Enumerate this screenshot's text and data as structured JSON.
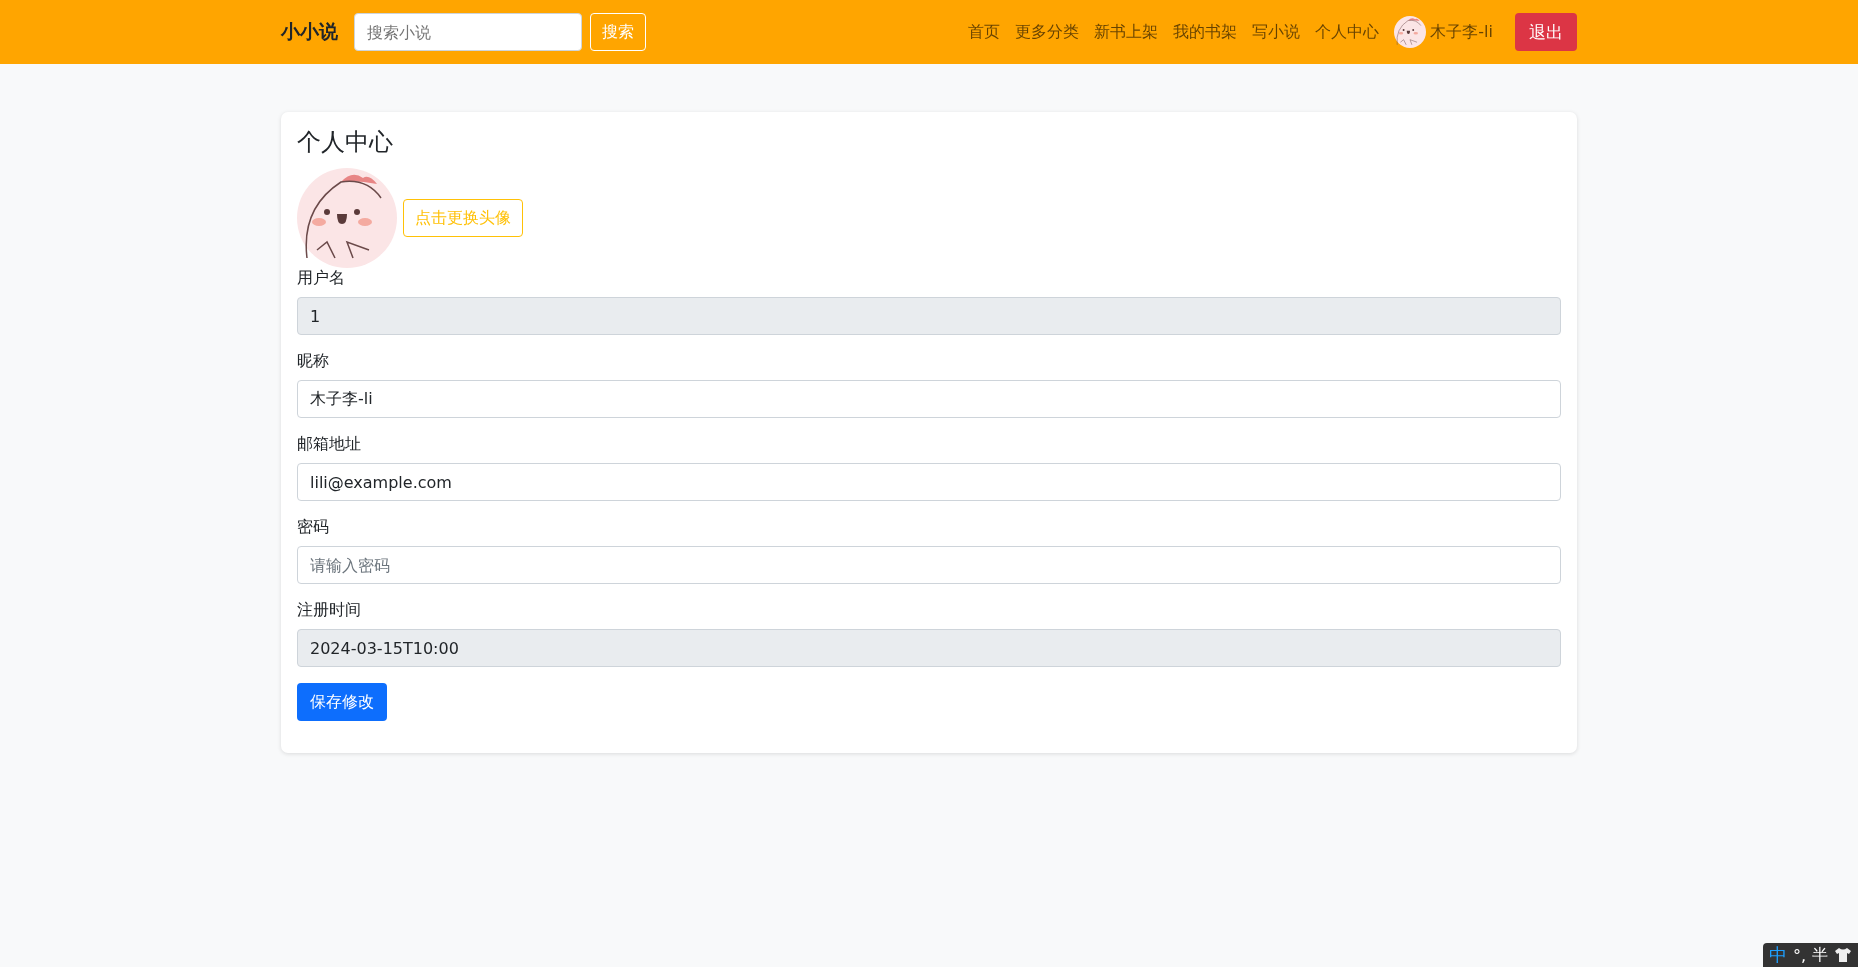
{
  "navbar": {
    "brand": "小小说",
    "search": {
      "placeholder": "搜索小说",
      "button": "搜索"
    },
    "links": [
      {
        "label": "首页"
      },
      {
        "label": "更多分类"
      },
      {
        "label": "新书上架"
      },
      {
        "label": "我的书架"
      },
      {
        "label": "写小说"
      },
      {
        "label": "个人中心"
      }
    ],
    "user": {
      "name": "木子李-li"
    },
    "logout": "退出"
  },
  "card": {
    "title": "个人中心",
    "change_avatar": "点击更换头像",
    "fields": [
      {
        "label": "用户名",
        "value": "1",
        "disabled": true
      },
      {
        "label": "昵称",
        "value": "木子李-li",
        "disabled": false
      },
      {
        "label": "邮箱地址",
        "value": "lili@example.com",
        "disabled": false
      },
      {
        "label": "密码",
        "placeholder": "请输入密码",
        "disabled": false
      },
      {
        "label": "注册时间",
        "value": "2024-03-15T10:00",
        "disabled": true
      }
    ],
    "save": "保存修改"
  },
  "ime_bar": {
    "mode": "中",
    "punct": "°,",
    "width": "半"
  }
}
